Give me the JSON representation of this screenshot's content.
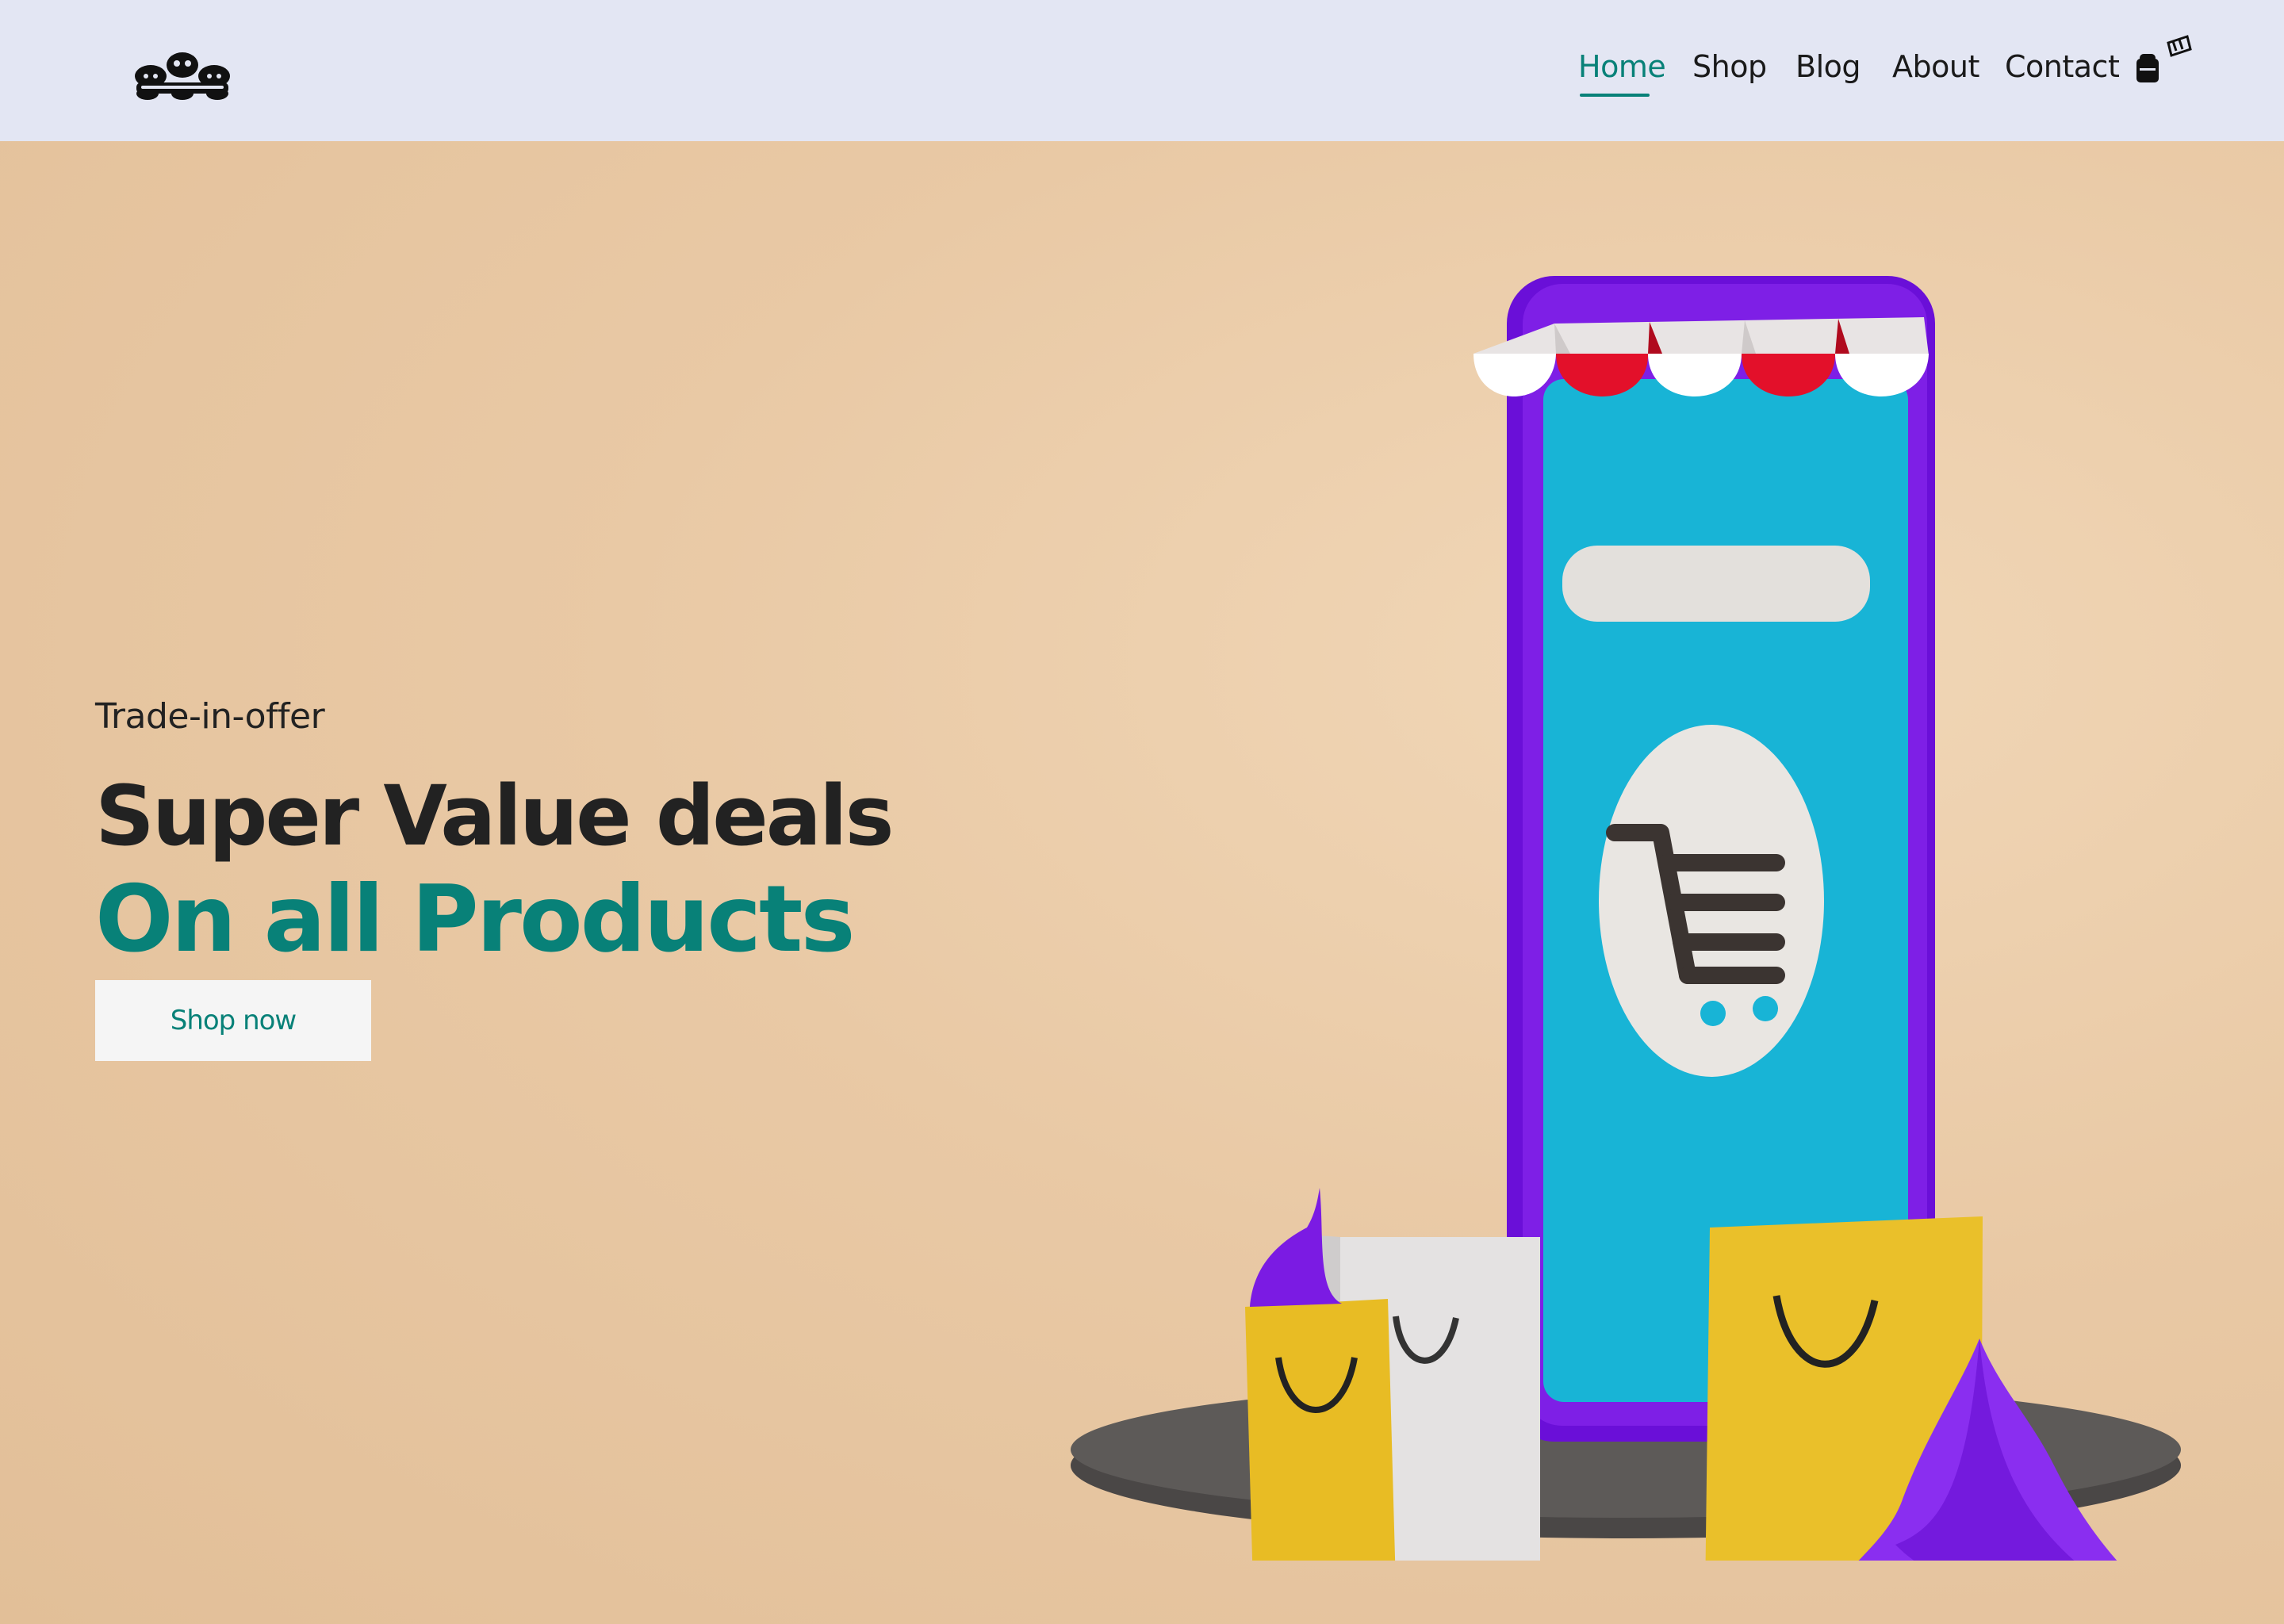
{
  "header": {
    "logo_name": "site-logo",
    "nav": [
      {
        "label": "Home",
        "active": true
      },
      {
        "label": "Shop",
        "active": false
      },
      {
        "label": "Blog",
        "active": false
      },
      {
        "label": "About",
        "active": false
      },
      {
        "label": "Contact",
        "active": false
      }
    ],
    "cart_icon": "shopping-bag-icon"
  },
  "hero": {
    "kicker": "Trade-in-offer",
    "headline": "Super Value deals",
    "subheadline": "On all Products",
    "button_label": "Shop now",
    "illustration": "online-store-phone-illustration"
  },
  "colors": {
    "accent": "#088178",
    "header_bg": "#e3e6f3",
    "hero_bg": "#e9cba8",
    "text": "#222222"
  }
}
